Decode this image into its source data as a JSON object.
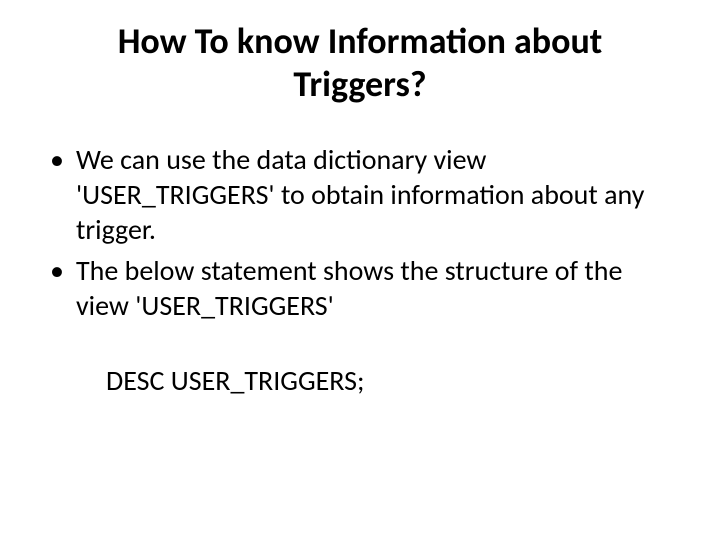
{
  "title": "How To know Information about Triggers?",
  "bullets": [
    "We can use the data dictionary view 'USER_TRIGGERS' to obtain information about any trigger.",
    "The below statement shows the structure of the view 'USER_TRIGGERS'"
  ],
  "code": "DESC USER_TRIGGERS;"
}
